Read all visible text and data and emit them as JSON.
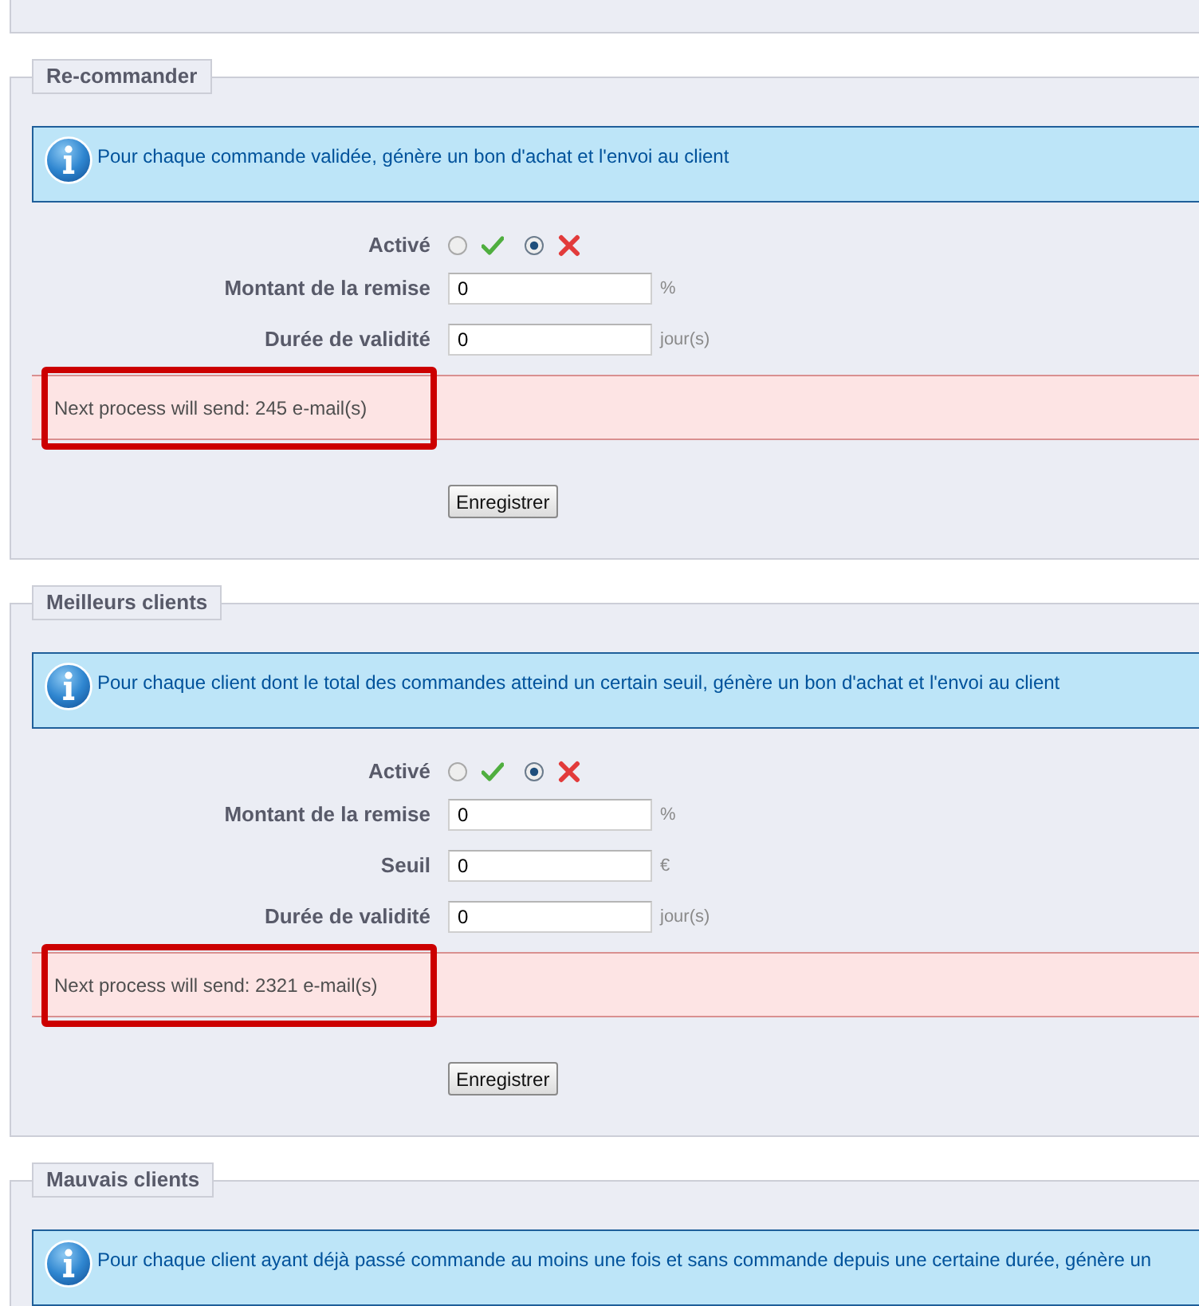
{
  "sections": [
    {
      "title": "Re-commander",
      "info": "Pour chaque commande validée, génère un bon d'achat et l'envoi au client",
      "toggle": {
        "label": "Activé",
        "options": [
          {
            "kind": "yes",
            "selected": false
          },
          {
            "kind": "no",
            "selected": true
          }
        ]
      },
      "fields": [
        {
          "label": "Montant de la remise",
          "value": "0",
          "unit": "%"
        },
        {
          "label": "Durée de validité",
          "value": "0",
          "unit": "jour(s)"
        }
      ],
      "notice": {
        "text": "Next process will send: 245 e-mail(s)",
        "highlighted": true
      },
      "button": "Enregistrer"
    },
    {
      "title": "Meilleurs clients",
      "info": "Pour chaque client dont le total des commandes atteind un certain seuil, génère un bon d'achat et l'envoi au client",
      "toggle": {
        "label": "Activé",
        "options": [
          {
            "kind": "yes",
            "selected": false
          },
          {
            "kind": "no",
            "selected": true
          }
        ]
      },
      "fields": [
        {
          "label": "Montant de la remise",
          "value": "0",
          "unit": "%"
        },
        {
          "label": "Seuil",
          "value": "0",
          "unit": "€"
        },
        {
          "label": "Durée de validité",
          "value": "0",
          "unit": "jour(s)"
        }
      ],
      "notice": {
        "text": "Next process will send: 2321 e-mail(s)",
        "highlighted": true
      },
      "button": "Enregistrer"
    },
    {
      "title": "Mauvais clients",
      "info": "Pour chaque client ayant déjà passé commande au moins une fois et sans commande depuis une certaine durée, génère un"
    }
  ]
}
